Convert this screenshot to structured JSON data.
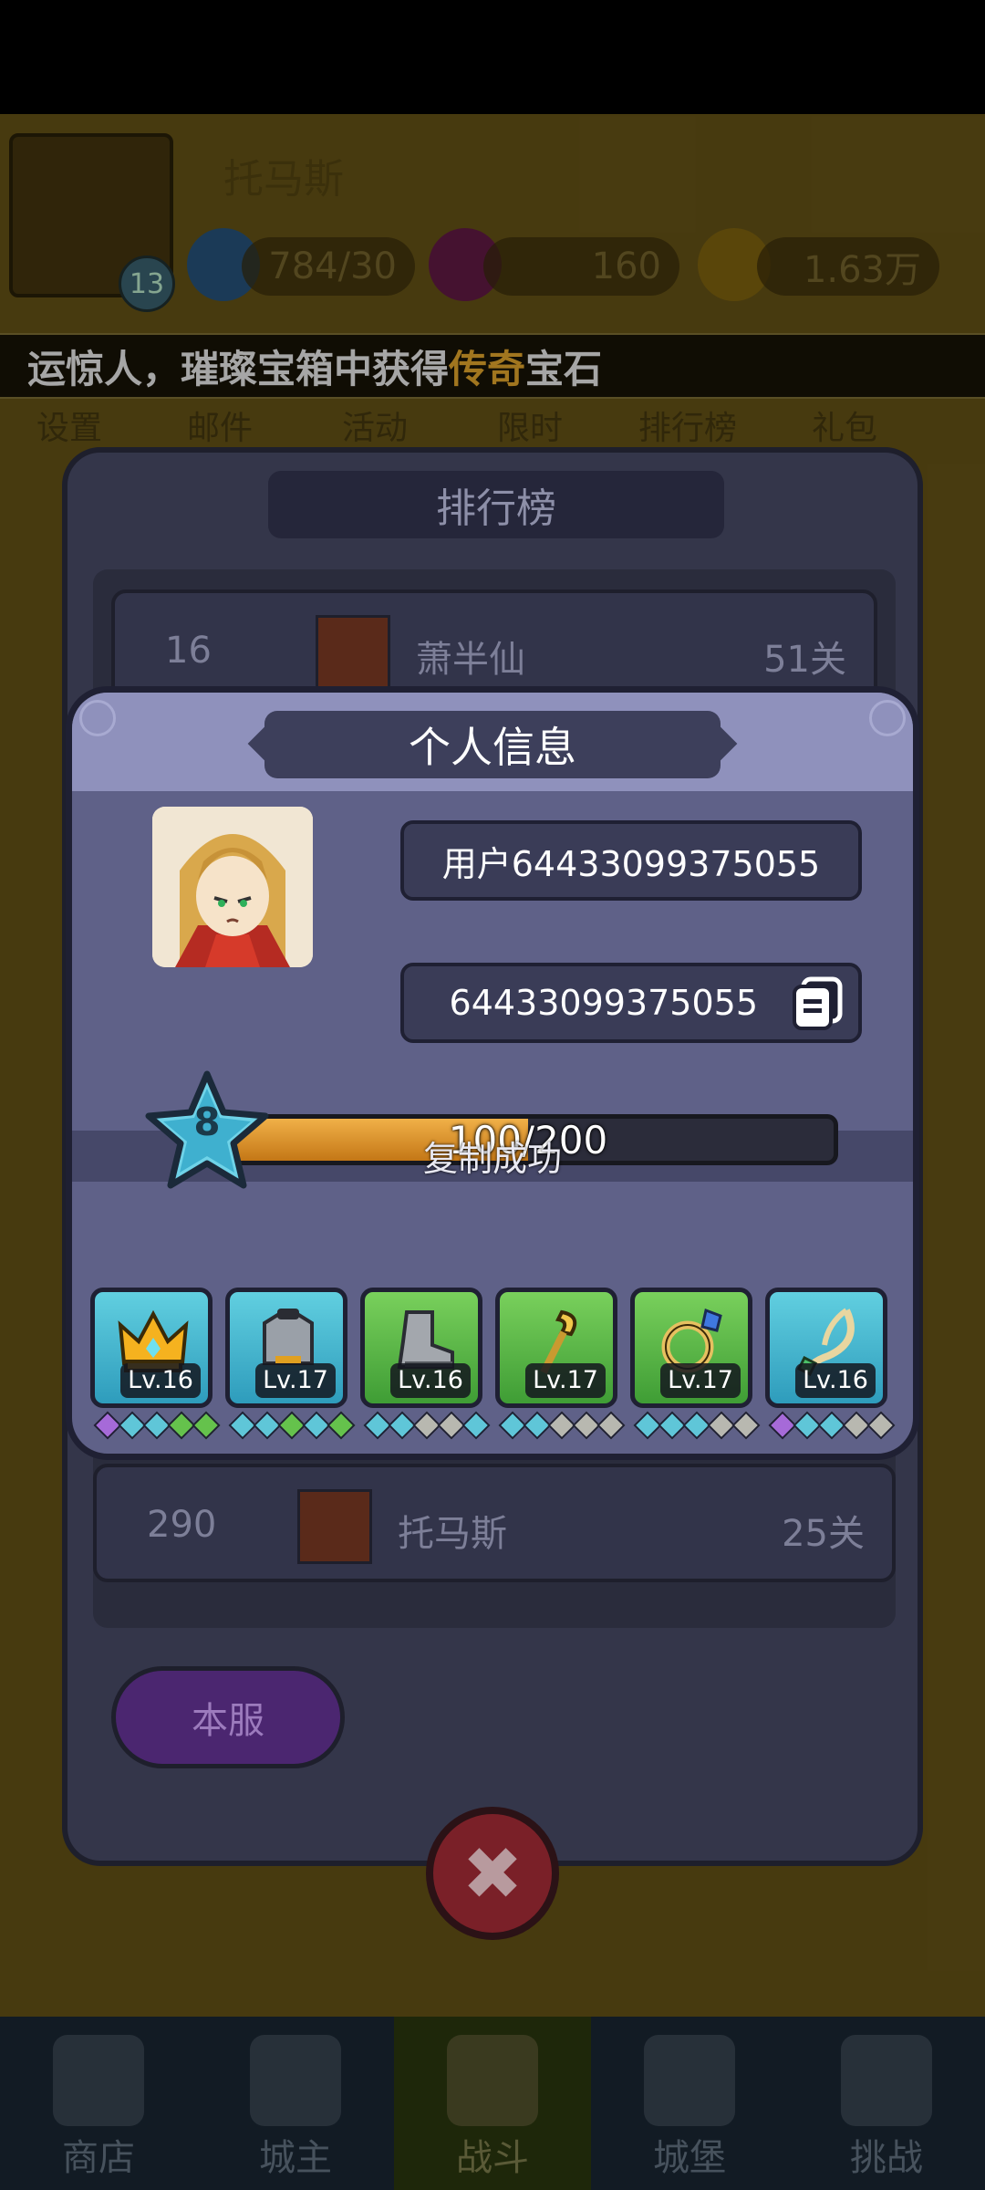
{
  "background": {
    "player_name": "托马斯",
    "player_level": "13",
    "stats": {
      "energy": "784/30",
      "gems": "160",
      "gold": "1.63万"
    },
    "marquee": {
      "prefix": "运惊人，璀璨宝箱中获得",
      "highlight": "传奇",
      "suffix": "宝石"
    },
    "side_menu": [
      "设置",
      "邮件",
      "活动",
      "限时",
      "排行榜",
      "礼包"
    ],
    "nav": [
      {
        "label": "商店",
        "active": false
      },
      {
        "label": "城主",
        "active": false
      },
      {
        "label": "战斗",
        "active": true
      },
      {
        "label": "城堡",
        "active": false
      },
      {
        "label": "挑战",
        "active": false
      }
    ]
  },
  "ranking_panel": {
    "title": "排行榜",
    "rows": [
      {
        "rank": "16",
        "name": "萧半仙",
        "stage": "51关"
      },
      {
        "rank": "290",
        "name": "托马斯",
        "stage": "25关"
      }
    ],
    "server_button": "本服"
  },
  "info_modal": {
    "title": "个人信息",
    "username": "用户64433099375055",
    "user_id": "64433099375055",
    "level": "8",
    "xp_text": "100/200",
    "xp_progress": 0.5,
    "toast": "复制成功",
    "equipment": [
      {
        "icon": "crown-icon",
        "level": "Lv.16",
        "rarity": "blue",
        "gems": [
          "purple",
          "blue",
          "blue",
          "green",
          "green"
        ]
      },
      {
        "icon": "armor-icon",
        "level": "Lv.17",
        "rarity": "blue",
        "gems": [
          "blue",
          "blue",
          "green",
          "blue",
          "green"
        ]
      },
      {
        "icon": "boots-icon",
        "level": "Lv.16",
        "rarity": "green",
        "gems": [
          "blue",
          "blue",
          "grey",
          "grey",
          "blue"
        ]
      },
      {
        "icon": "staff-icon",
        "level": "Lv.17",
        "rarity": "green",
        "gems": [
          "blue",
          "blue",
          "grey",
          "grey",
          "grey"
        ]
      },
      {
        "icon": "ring-icon",
        "level": "Lv.17",
        "rarity": "green",
        "gems": [
          "blue",
          "blue",
          "blue",
          "grey",
          "grey"
        ]
      },
      {
        "icon": "necklace-icon",
        "level": "Lv.16",
        "rarity": "blue",
        "gems": [
          "purple",
          "blue",
          "blue",
          "grey",
          "grey"
        ]
      }
    ]
  },
  "colors": {
    "accent_orange": "#f7b530",
    "modal_bg": "#5f6188",
    "xp_fill": "#e39a2c"
  }
}
